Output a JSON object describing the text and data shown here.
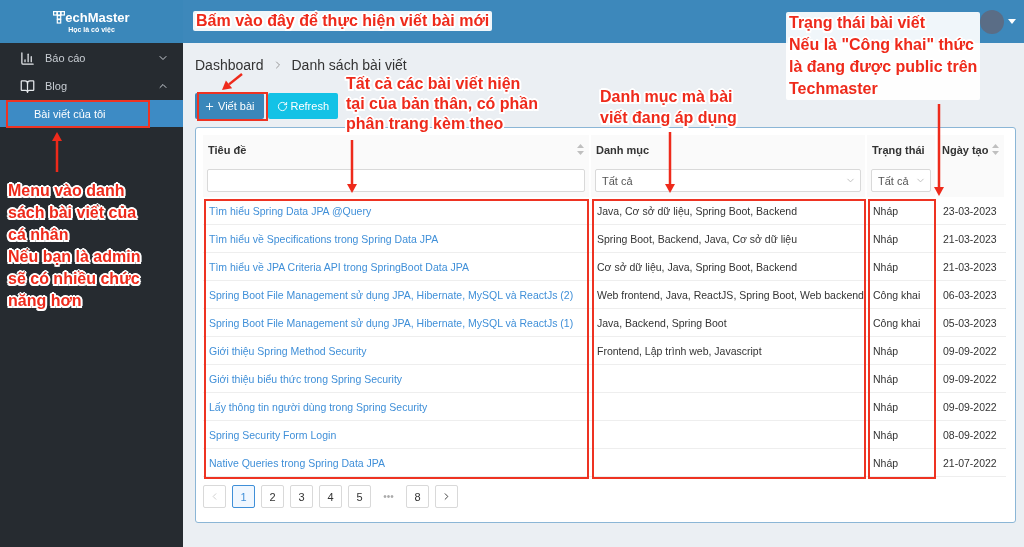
{
  "sidebar": {
    "logo": {
      "name": "echMaster",
      "tagline": "Học là có việc"
    },
    "menu": [
      {
        "label": "Báo cáo",
        "expanded": false
      },
      {
        "label": "Blog",
        "expanded": true,
        "children": [
          {
            "label": "Bài viết của tôi",
            "selected": true
          }
        ]
      }
    ]
  },
  "breadcrumb": [
    "Dashboard",
    "Danh sách bài viết"
  ],
  "toolbar": [
    {
      "label": "Viết bài",
      "kind": "primary"
    },
    {
      "label": "Refresh",
      "kind": "refresh"
    }
  ],
  "table": {
    "columns": [
      {
        "label": "Tiêu đề",
        "sortable": true,
        "filter": {
          "kind": "text"
        }
      },
      {
        "label": "Danh mục",
        "sortable": false,
        "filter": {
          "kind": "select",
          "value": "Tất cả"
        }
      },
      {
        "label": "Trạng thái",
        "sortable": false,
        "filter": {
          "kind": "select",
          "value": "Tất cả"
        }
      },
      {
        "label": "Ngày tạo",
        "sortable": true,
        "filter": {
          "kind": "none"
        }
      }
    ],
    "rows": [
      {
        "title": "Tìm hiểu Spring Data JPA @Query",
        "categories": "Java, Cơ sở dữ liệu, Spring Boot, Backend",
        "status": "Nháp",
        "date": "23-03-2023"
      },
      {
        "title": "Tìm hiểu về Specifications trong Spring Data JPA",
        "categories": "Spring Boot, Backend, Java, Cơ sở dữ liệu",
        "status": "Nháp",
        "date": "21-03-2023"
      },
      {
        "title": "Tìm hiểu về JPA Criteria API trong SpringBoot Data JPA",
        "categories": "Cơ sở dữ liệu, Java, Spring Boot, Backend",
        "status": "Nháp",
        "date": "21-03-2023"
      },
      {
        "title": "Spring Boot File Management sử dụng JPA, Hibernate, MySQL và ReactJs (2)",
        "categories": "Web frontend, Java, ReactJS, Spring Boot, Web backend",
        "status": "Công khai",
        "date": "06-03-2023"
      },
      {
        "title": "Spring Boot File Management sử dụng JPA, Hibernate, MySQL và ReactJs (1)",
        "categories": "Java, Backend, Spring Boot",
        "status": "Công khai",
        "date": "05-03-2023"
      },
      {
        "title": "Giới thiệu Spring Method Security",
        "categories": "Frontend, Lập trình web, Javascript",
        "status": "Nháp",
        "date": "09-09-2022"
      },
      {
        "title": "Giới thiệu biểu thức trong Spring Security",
        "categories": "",
        "status": "Nháp",
        "date": "09-09-2022"
      },
      {
        "title": "Lấy thông tin người dùng trong Spring Security",
        "categories": "",
        "status": "Nháp",
        "date": "09-09-2022"
      },
      {
        "title": "Spring Security Form Login",
        "categories": "",
        "status": "Nháp",
        "date": "08-09-2022"
      },
      {
        "title": "Native Queries trong Spring Data JPA",
        "categories": "",
        "status": "Nháp",
        "date": "21-07-2022"
      }
    ]
  },
  "pagination": {
    "prev_disabled": true,
    "next_disabled": false,
    "items": [
      {
        "label": "1",
        "kind": "page",
        "selected": true
      },
      {
        "label": "2",
        "kind": "page",
        "selected": false
      },
      {
        "label": "3",
        "kind": "page",
        "selected": false
      },
      {
        "label": "4",
        "kind": "page",
        "selected": false
      },
      {
        "label": "5",
        "kind": "page",
        "selected": false
      },
      {
        "label": "•••",
        "kind": "ellipsis",
        "selected": false
      },
      {
        "label": "8",
        "kind": "page",
        "selected": false
      }
    ]
  },
  "annotations": [
    {
      "lines": [
        "Bấm vào đây để thực hiện viết bài mới"
      ]
    },
    {
      "lines": [
        "Tất cả các bài viết hiện",
        "tại của bản thân, có phần",
        "phân trang kèm theo"
      ]
    },
    {
      "lines": [
        "Danh mục mà bài",
        "viết đang áp dụng"
      ]
    },
    {
      "lines": [
        "Trạng thái bài viết",
        "Nếu là \"Công khai\" thức",
        "là đang được public trên",
        "Techmaster"
      ]
    },
    {
      "lines": [
        "Menu vào danh",
        "sách bài viết của",
        "cá nhân",
        "Nếu bạn là admin",
        "sẽ có nhiều chức",
        "năng hơn"
      ]
    }
  ]
}
